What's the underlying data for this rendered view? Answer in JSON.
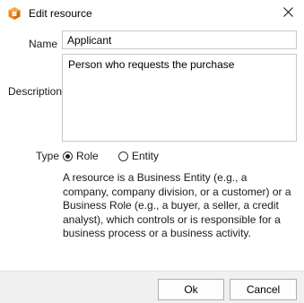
{
  "dialog": {
    "title": "Edit resource",
    "icon": "app-icon",
    "close_icon": "close-icon"
  },
  "form": {
    "name_label": "Name",
    "name_value": "Applicant",
    "description_label": "Description",
    "description_value": "Person who requests the purchase",
    "type_label": "Type",
    "type_options": [
      "Role",
      "Entity"
    ],
    "type_selected": "Role",
    "help_text": "A resource is a Business Entity (e.g., a company, company division, or a customer) or a Business Role (e.g., a buyer, a seller, a credit analyst), which controls or is responsible for a business process or a business activity."
  },
  "buttons": {
    "ok_label": "Ok",
    "cancel_label": "Cancel"
  },
  "colors": {
    "app_icon_orange": "#e8881a",
    "footer_bg": "#f0f0f0"
  }
}
